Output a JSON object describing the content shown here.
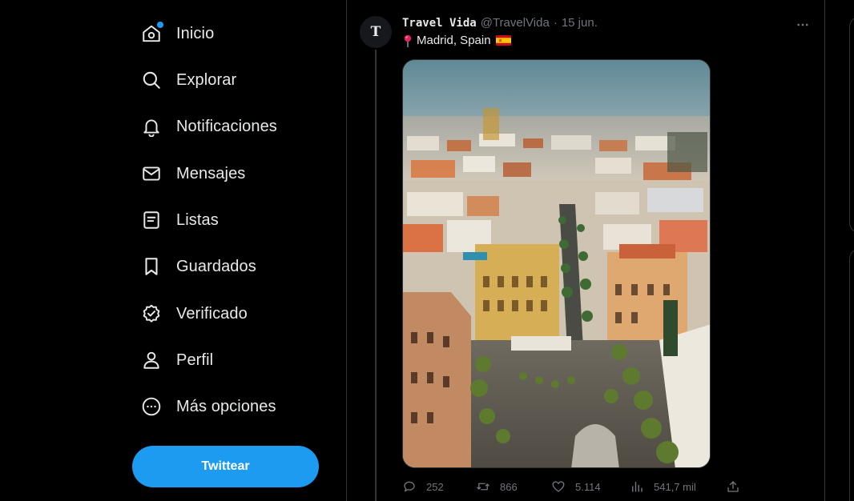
{
  "sidebar": {
    "items": [
      {
        "label": "Inicio",
        "icon": "home-icon",
        "has_dot": true
      },
      {
        "label": "Explorar",
        "icon": "search-icon"
      },
      {
        "label": "Notificaciones",
        "icon": "bell-icon"
      },
      {
        "label": "Mensajes",
        "icon": "envelope-icon"
      },
      {
        "label": "Listas",
        "icon": "list-icon"
      },
      {
        "label": "Guardados",
        "icon": "bookmark-icon"
      },
      {
        "label": "Verificado",
        "icon": "verified-icon"
      },
      {
        "label": "Perfil",
        "icon": "person-icon"
      },
      {
        "label": "Más opciones",
        "icon": "more-circle-icon"
      }
    ],
    "tweet_button": "Twittear"
  },
  "tweet": {
    "avatar_letter": "T",
    "display_name": "Travel Vida",
    "handle": "@TravelVida",
    "separator": "·",
    "date": "15 jun.",
    "text": "Madrid, Spain",
    "stats": {
      "replies": "252",
      "retweets": "866",
      "likes": "5.114",
      "views": "541,7 mil"
    }
  },
  "colors": {
    "accent": "#1d9bf0",
    "text_primary": "#e7e9ea",
    "text_secondary": "#71767b",
    "border": "#2f3336"
  }
}
